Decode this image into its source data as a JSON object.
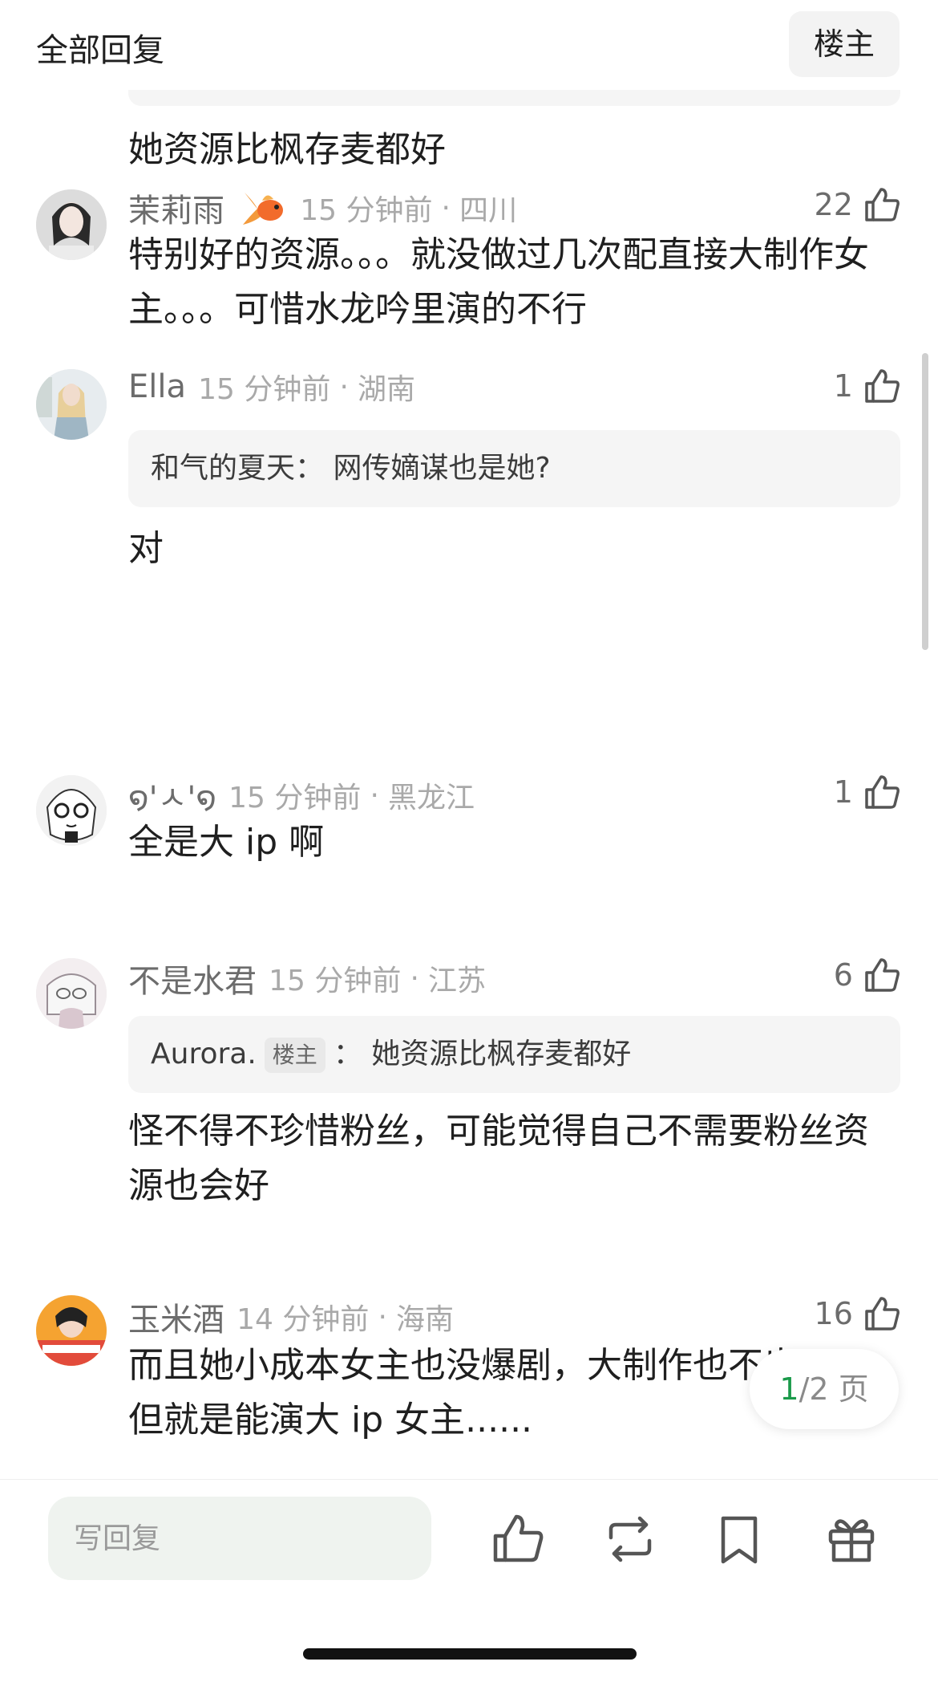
{
  "header": {
    "title": "全部回复",
    "op_button_label": "楼主"
  },
  "previous_comment_tail": "她资源比枫存麦都好",
  "comments": [
    {
      "user": "茉莉雨",
      "time": "15 分钟前",
      "location": "四川",
      "likes": "22",
      "text": "特别好的资源。。。就没做过几次配直接大制作女主。。。可惜水龙吟里演的不行"
    },
    {
      "user": "Ella",
      "time": "15 分钟前",
      "location": "湖南",
      "likes": "1",
      "quote": {
        "author": "和气的夏天",
        "text": "网传嫡谋也是她?"
      },
      "text": "对"
    },
    {
      "user": "໑'ㅅ'໑",
      "time": "15 分钟前",
      "location": "黑龙江",
      "likes": "1",
      "text": "全是大 ip 啊"
    },
    {
      "user": "不是水君",
      "time": "15 分钟前",
      "location": "江苏",
      "likes": "6",
      "quote": {
        "author": "Aurora.",
        "badge": "楼主",
        "text": "她资源比枫存麦都好"
      },
      "text": "怪不得不珍惜粉丝，可能觉得自己不需要粉丝资源也会好"
    },
    {
      "user": "玉米酒",
      "time": "14 分钟前",
      "location": "海南",
      "likes": "16",
      "text": "而且她小成本女主也没爆剧，大制作也不出圈，但就是能演大 ip 女主......"
    }
  ],
  "pagination": {
    "current": "1",
    "total_text": "/2 页"
  },
  "bottom_bar": {
    "reply_placeholder": "写回复",
    "icons": [
      "like-icon",
      "repost-icon",
      "bookmark-icon",
      "gift-icon"
    ]
  },
  "colors": {
    "accent_green": "#1a9a4a",
    "meta_gray": "#a9a9a9",
    "name_gray": "#6c6c6c"
  }
}
